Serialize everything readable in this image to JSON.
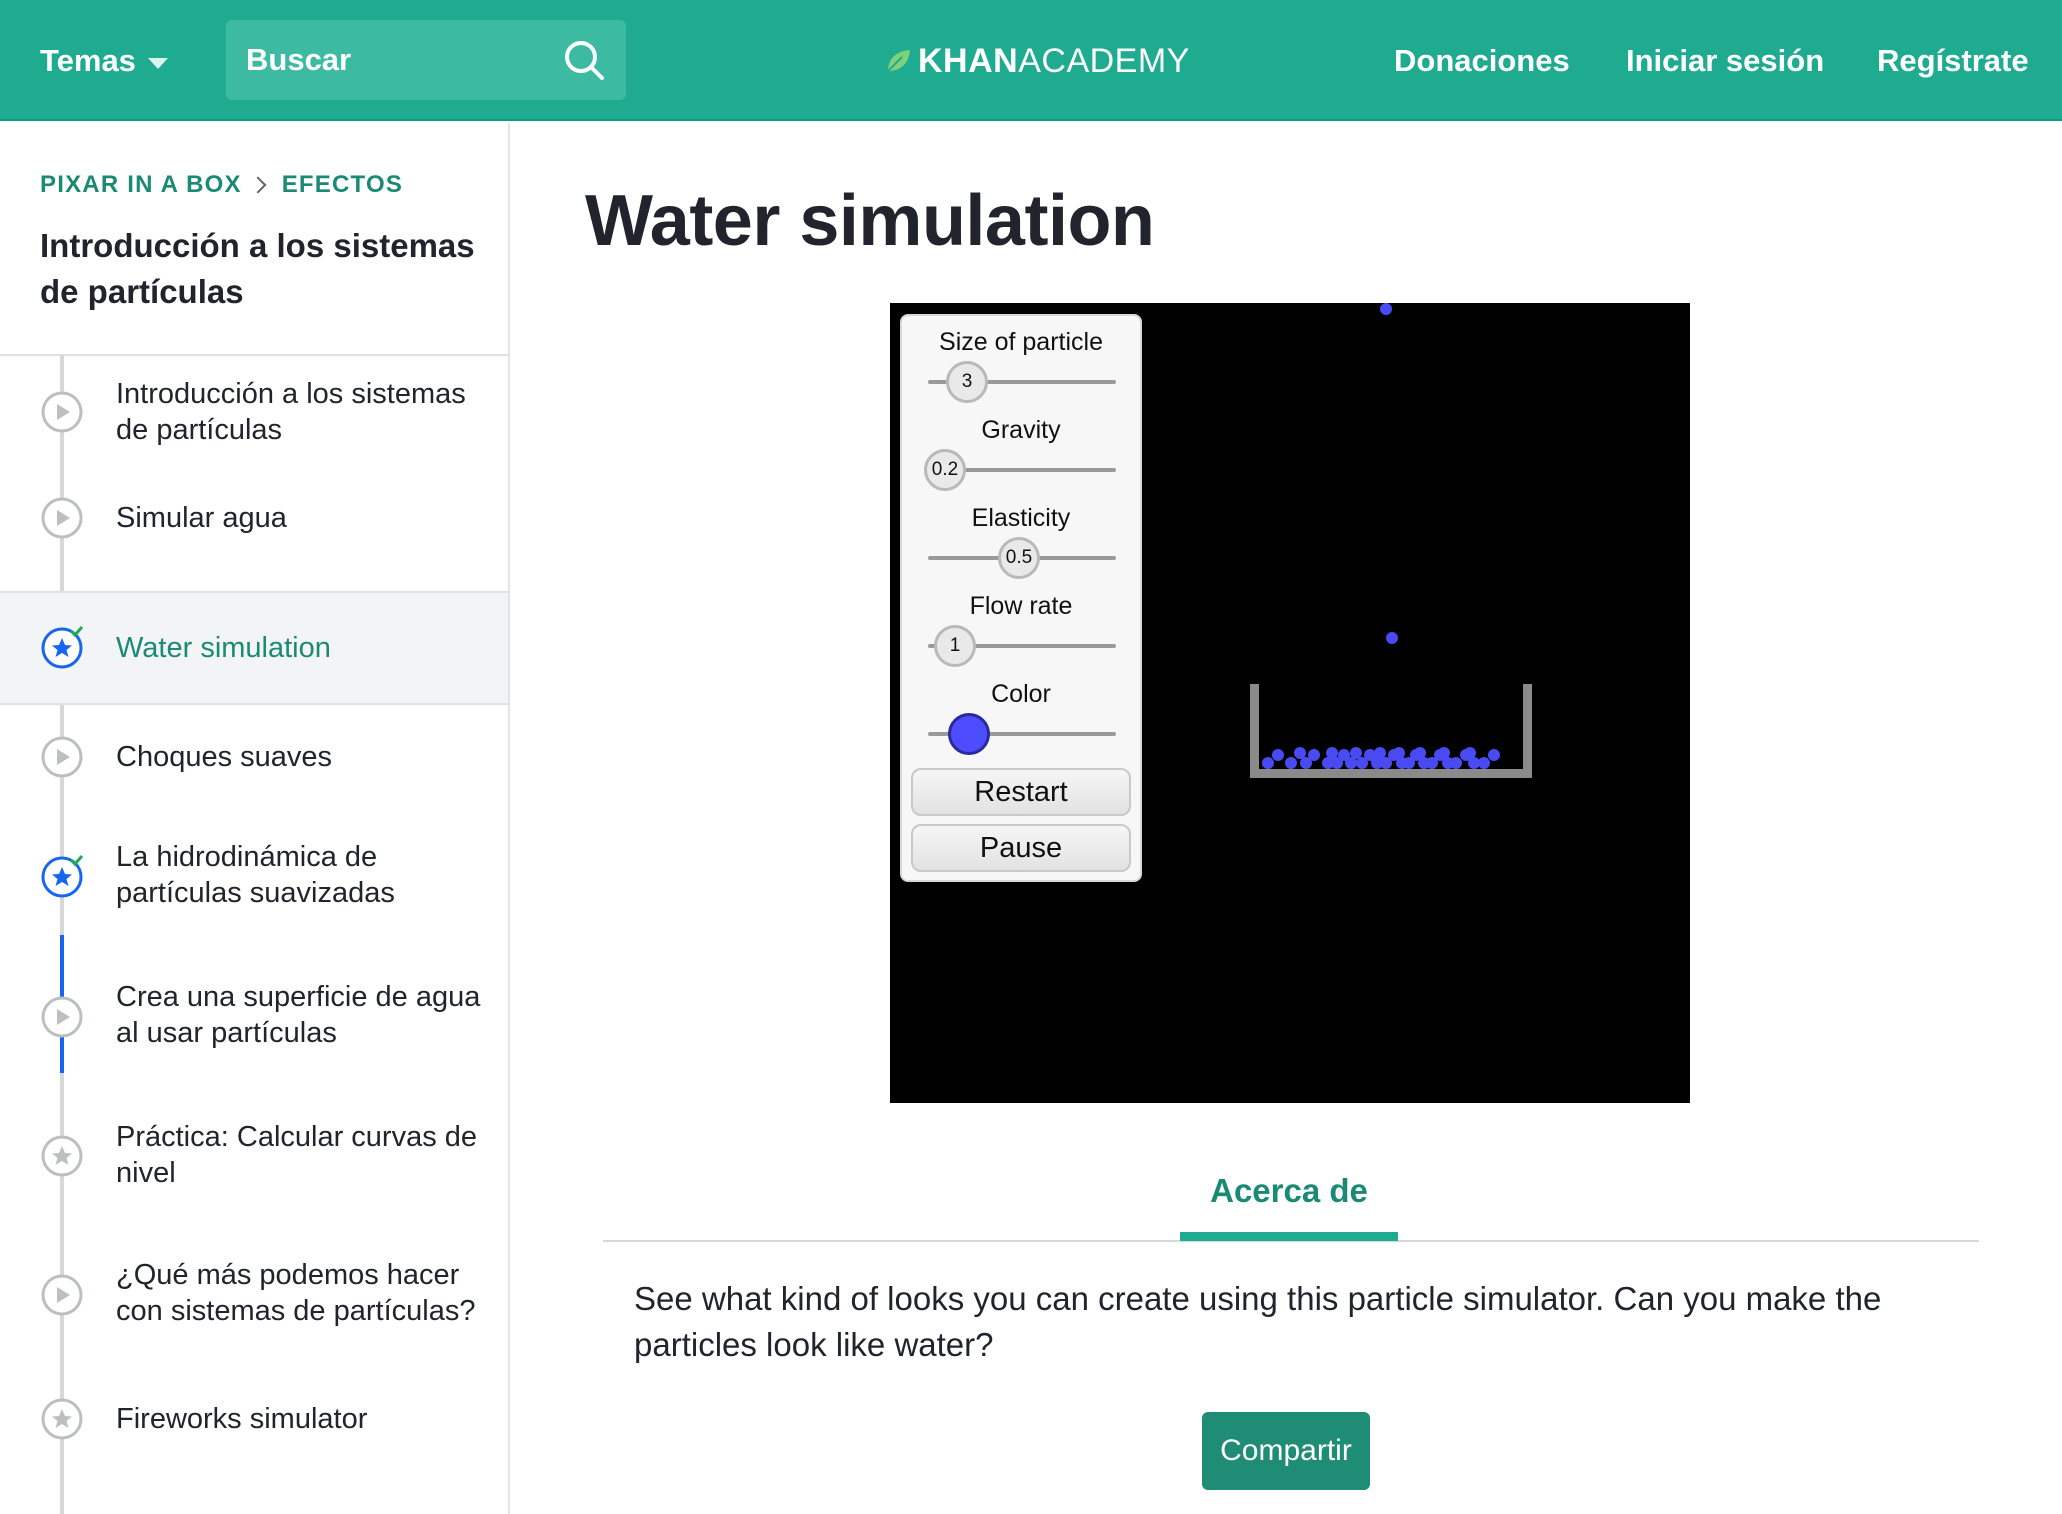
{
  "header": {
    "topics_label": "Temas",
    "search_label": "Buscar",
    "logo_bold": "KHAN",
    "logo_light": "ACADEMY",
    "donate_label": "Donaciones",
    "login_label": "Iniciar sesión",
    "signup_label": "Regístrate",
    "brand_color": "#1fab90"
  },
  "sidebar": {
    "breadcrumb": [
      "PIXAR IN A BOX",
      "EFECTOS"
    ],
    "unit_title": "Introducción a los sistemas de partículas",
    "items": [
      {
        "label": "Introducción a los sistemas de partículas",
        "type": "video",
        "state": "default"
      },
      {
        "label": "Simular agua",
        "type": "video",
        "state": "default"
      },
      {
        "label": "Water simulation",
        "type": "project",
        "state": "active-completed"
      },
      {
        "label": "Choques suaves",
        "type": "video",
        "state": "default"
      },
      {
        "label": "La hidrodinámica de partículas suavizadas",
        "type": "project",
        "state": "completed"
      },
      {
        "label": "Crea una superficie de agua al usar partículas",
        "type": "video",
        "state": "default"
      },
      {
        "label": "Práctica: Calcular curvas de nivel",
        "type": "exercise",
        "state": "default"
      },
      {
        "label": "¿Qué más podemos hacer con sistemas de partículas?",
        "type": "video",
        "state": "default"
      },
      {
        "label": "Fireworks simulator",
        "type": "project",
        "state": "default"
      }
    ]
  },
  "main": {
    "title": "Water simulation",
    "simulation": {
      "controls": {
        "size_label": "Size of particle",
        "size_value": "3",
        "gravity_label": "Gravity",
        "gravity_value": "0.2",
        "elasticity_label": "Elasticity",
        "elasticity_value": "0.5",
        "flow_label": "Flow rate",
        "flow_value": "1",
        "color_label": "Color",
        "particle_color": "#4a4af2"
      },
      "restart_label": "Restart",
      "pause_label": "Pause"
    },
    "tab_label": "Acerca de",
    "description": "See what kind of looks you can create using this particle simulator. Can you make the particles look like water?",
    "share_label": "Compartir"
  }
}
